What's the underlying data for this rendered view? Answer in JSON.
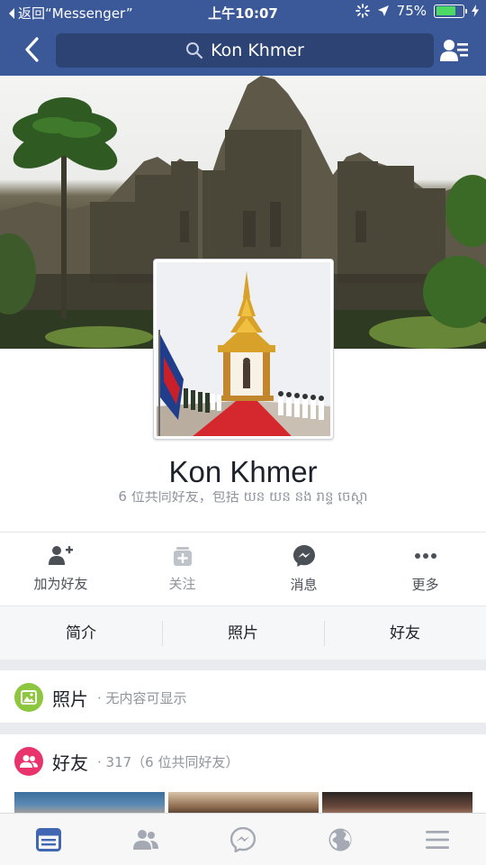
{
  "status_bar": {
    "back_label": "返回“Messenger”",
    "time": "上午10:07",
    "battery_percent": "75%",
    "battery_level": 0.75
  },
  "nav": {
    "search_text": "Kon Khmer",
    "icons": {
      "back": "chevron-left-icon",
      "search": "search-icon",
      "friend_requests": "friend-list-icon"
    }
  },
  "profile": {
    "name": "Kon Khmer",
    "mutual_friends": "6 位共同好友，包括 យន់ យន់ និង រ៉ាន្ទី ចេស្តា"
  },
  "actions": [
    {
      "label": "加为好友",
      "icon": "add-friend-icon",
      "enabled": true
    },
    {
      "label": "关注",
      "icon": "follow-icon",
      "enabled": false
    },
    {
      "label": "消息",
      "icon": "messenger-icon",
      "enabled": true
    },
    {
      "label": "更多",
      "icon": "more-icon",
      "enabled": true
    }
  ],
  "tabs": [
    {
      "label": "简介"
    },
    {
      "label": "照片"
    },
    {
      "label": "好友"
    }
  ],
  "photos": {
    "title": "照片",
    "subtitle": " · 无内容可显示",
    "icon_color": "#8dc63f"
  },
  "friends": {
    "title": "好友",
    "subtitle": " · 317（6 位共同好友）",
    "icon_color": "#e8336d"
  },
  "bottom_tabs": [
    {
      "icon": "news-feed-icon",
      "active": true
    },
    {
      "icon": "friends-icon",
      "active": false
    },
    {
      "icon": "messenger-icon",
      "active": false
    },
    {
      "icon": "notifications-globe-icon",
      "active": false
    },
    {
      "icon": "menu-icon",
      "active": false
    }
  ],
  "colors": {
    "brand": "#3b5998",
    "active_tab": "#4267b2",
    "inactive_icon": "#a4a9b3"
  }
}
